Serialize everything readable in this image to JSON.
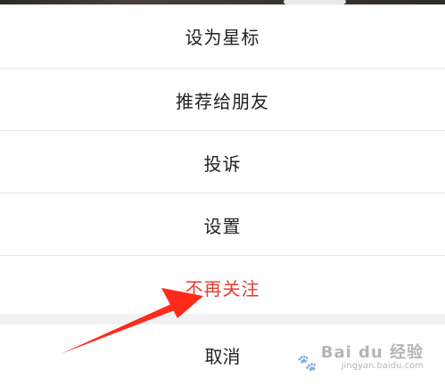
{
  "action_sheet": {
    "items": [
      {
        "label": "设为星标"
      },
      {
        "label": "推荐给朋友"
      },
      {
        "label": "投诉"
      },
      {
        "label": "设置"
      },
      {
        "label": "不再关注"
      }
    ],
    "cancel_label": "取消",
    "danger_color": "#e63b2e"
  },
  "annotation": {
    "arrow_color": "#ff2a1a"
  },
  "watermark": {
    "text": "Bai du 经验",
    "sub": "jingyan.baidu.com"
  }
}
